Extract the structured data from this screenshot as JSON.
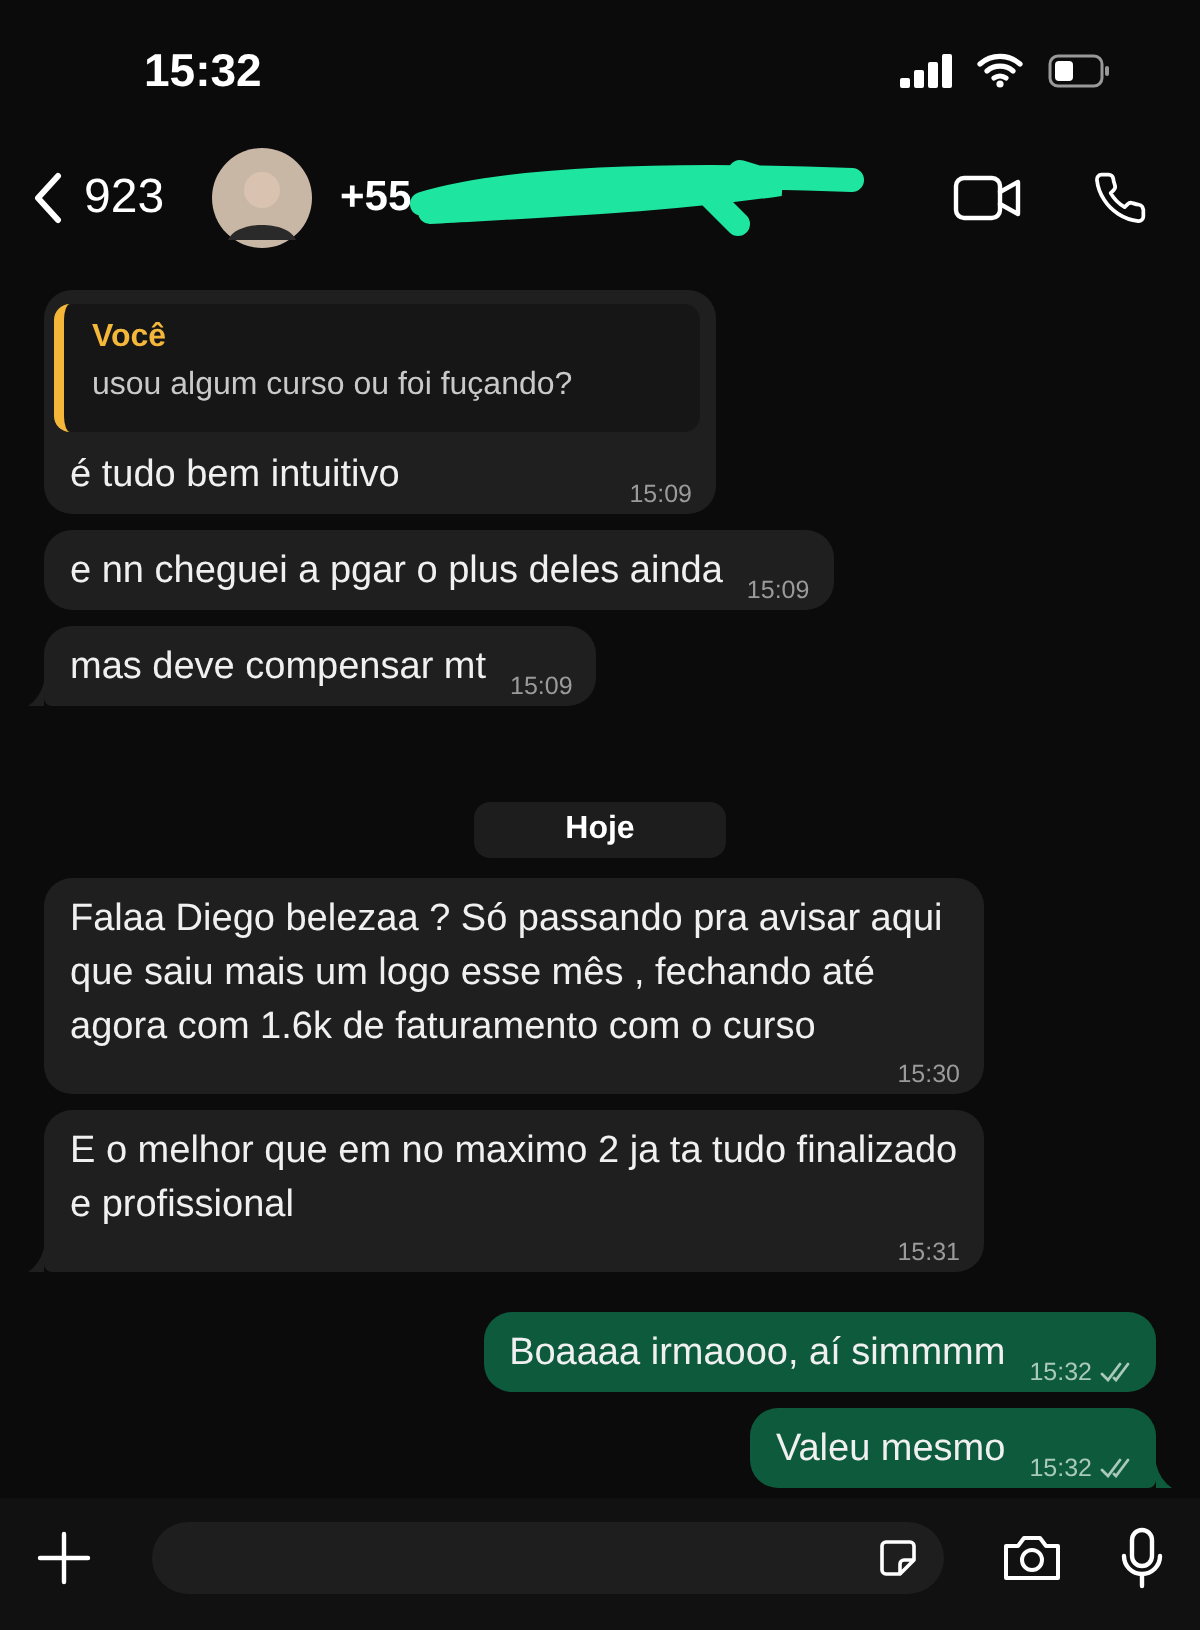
{
  "status_bar": {
    "time": "15:32"
  },
  "header": {
    "back_count": "923",
    "contact": "+55"
  },
  "messages": [
    {
      "kind": "incoming",
      "quote": {
        "author": "Você",
        "text": "usou algum curso ou foi fuçando?"
      },
      "text": "é tudo bem intuitivo",
      "time": "15:09",
      "tail": false
    },
    {
      "kind": "incoming",
      "text": "e nn cheguei a pgar o plus deles ainda",
      "time": "15:09",
      "tail": false
    },
    {
      "kind": "incoming",
      "text": "mas deve compensar mt",
      "time": "15:09",
      "tail": true
    },
    {
      "kind": "day",
      "text": "Hoje"
    },
    {
      "kind": "incoming",
      "text": "Falaa Diego belezaa ? Só passando pra avisar aqui que saiu mais um logo esse mês , fechando até agora com 1.6k de faturamento com o curso",
      "time": "15:30",
      "tail": false
    },
    {
      "kind": "incoming",
      "text": "E o melhor que em no maximo 2 ja ta tudo finalizado e profissional",
      "time": "15:31",
      "tail": true
    },
    {
      "kind": "outgoing",
      "text": "Boaaaa irmaooo, aí simmmm",
      "time": "15:32",
      "read": false,
      "tail": false
    },
    {
      "kind": "outgoing",
      "text": "Valeu mesmo",
      "time": "15:32",
      "read": false,
      "tail": true
    }
  ]
}
